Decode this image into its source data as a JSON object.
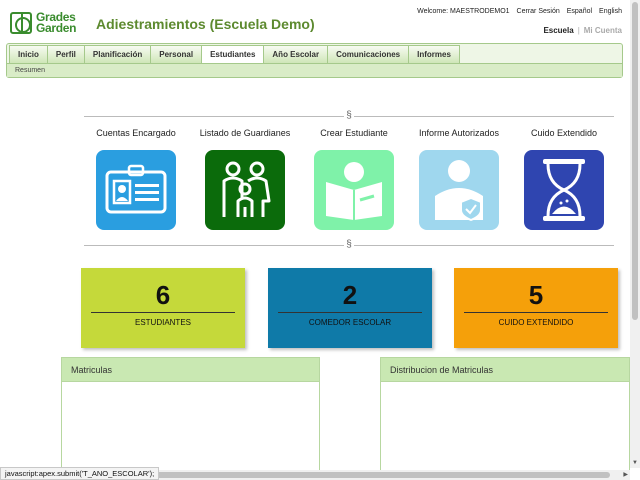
{
  "header": {
    "logo_lines": [
      "Grades",
      "Garden"
    ],
    "title": "Adiestramientos (Escuela Demo)",
    "welcome": "Welcome: MAESTRODEMO1",
    "logout": "Cerrar Sesión",
    "lang_es": "Español",
    "lang_en": "English",
    "mode_active": "Escuela",
    "mode_inactive": "Mi Cuenta"
  },
  "nav": {
    "tabs": [
      {
        "label": "Inicio"
      },
      {
        "label": "Perfil"
      },
      {
        "label": "Planificación"
      },
      {
        "label": "Personal"
      },
      {
        "label": "Estudiantes"
      },
      {
        "label": "Año Escolar"
      },
      {
        "label": "Comunicaciones"
      },
      {
        "label": "Informes"
      }
    ],
    "active_tab": "Estudiantes",
    "subnav": "Resumen"
  },
  "divider_symbol": "§",
  "shortcuts": [
    {
      "label": "Cuentas Encargado",
      "icon": "id-card-icon",
      "color": "#2a9ee0"
    },
    {
      "label": "Listado de Guardianes",
      "icon": "family-icon",
      "color": "#0b6b0b"
    },
    {
      "label": "Crear Estudiante",
      "icon": "student-reading-icon",
      "color": "#7ff2a9"
    },
    {
      "label": "Informe Autorizados",
      "icon": "authorized-person-icon",
      "color": "#9fd7ee"
    },
    {
      "label": "Cuido Extendido",
      "icon": "hourglass-icon",
      "color": "#2f45b0"
    }
  ],
  "stats": [
    {
      "value": "6",
      "label": "ESTUDIANTES",
      "color": "#c5d93a"
    },
    {
      "value": "2",
      "label": "COMEDOR ESCOLAR",
      "color": "#0f7aa8"
    },
    {
      "value": "5",
      "label": "CUIDO EXTENDIDO",
      "color": "#f5a00a"
    }
  ],
  "panels": [
    {
      "title": "Matriculas"
    },
    {
      "title": "Distribucion de Matriculas"
    }
  ],
  "status_bar": "javascript:apex.submit('T_ANO_ESCOLAR');"
}
